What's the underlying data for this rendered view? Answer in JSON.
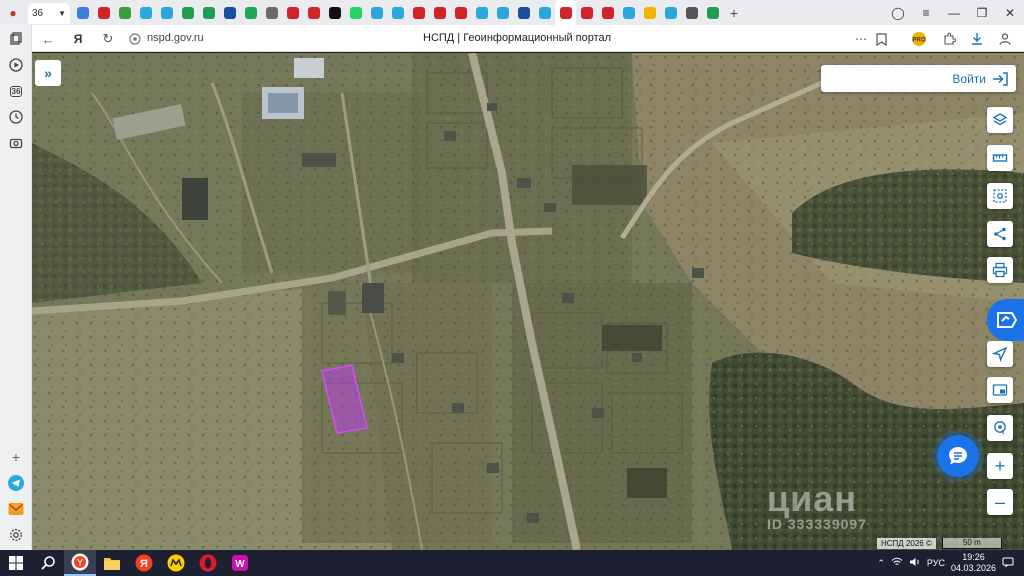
{
  "browser": {
    "tab_counter": "36",
    "address_url": "nspd.gov.ru",
    "page_title": "НСПД | Геоинформационный портал",
    "new_tab_label": "+",
    "tab_colors": [
      "#3b7ddd",
      "#d2232a",
      "#3a9d3a",
      "#2aa7df",
      "#2aa7df",
      "#1f9d55",
      "#1f9d55",
      "#1a4fa0",
      "#23a455",
      "#6a6a6a",
      "#d2232a",
      "#d2232a",
      "#111111",
      "#25d366",
      "#2aa7df",
      "#2aa7df",
      "#d2232a",
      "#d2232a",
      "#d2232a",
      "#2aa7df",
      "#2aa7df",
      "#1a4fa0",
      "#2aa7df",
      "#d2232a",
      "#d2232a",
      "#d2232a",
      "#2aa7df",
      "#f0b400",
      "#2aa7df",
      "#555555",
      "#1f9d55"
    ]
  },
  "sidebar": {
    "items": [
      {
        "icon": "collections-icon"
      },
      {
        "icon": "play-icon"
      },
      {
        "icon": "counter-36-icon",
        "label": "36"
      },
      {
        "icon": "history-icon"
      },
      {
        "icon": "camera-icon"
      },
      {
        "icon": "add-icon"
      },
      {
        "icon": "telegram-icon"
      },
      {
        "icon": "mail-icon"
      },
      {
        "icon": "settings-icon"
      }
    ]
  },
  "map": {
    "login_label": "Войти",
    "copyright": "НСПД 2026 ©",
    "scale_label": "50 m",
    "watermark_brand": "циан",
    "watermark_id": "ID 333339097",
    "controls": [
      "layers-icon",
      "ruler-icon",
      "select-area-icon",
      "share-icon",
      "print-icon",
      "locate-icon",
      "screen-icon",
      "geo-pin-icon",
      "zoom-in-icon",
      "zoom-out-icon"
    ],
    "highlight_color": "#c832ff"
  },
  "taskbar": {
    "apps": [
      "windows-start-icon",
      "search-icon",
      "yandex-browser-icon",
      "file-explorer-icon",
      "yandex-icon",
      "yandex-music-icon",
      "opera-icon",
      "wildberries-icon"
    ],
    "lang": "РУС",
    "time": "19:26",
    "date": "04.03.2026"
  }
}
